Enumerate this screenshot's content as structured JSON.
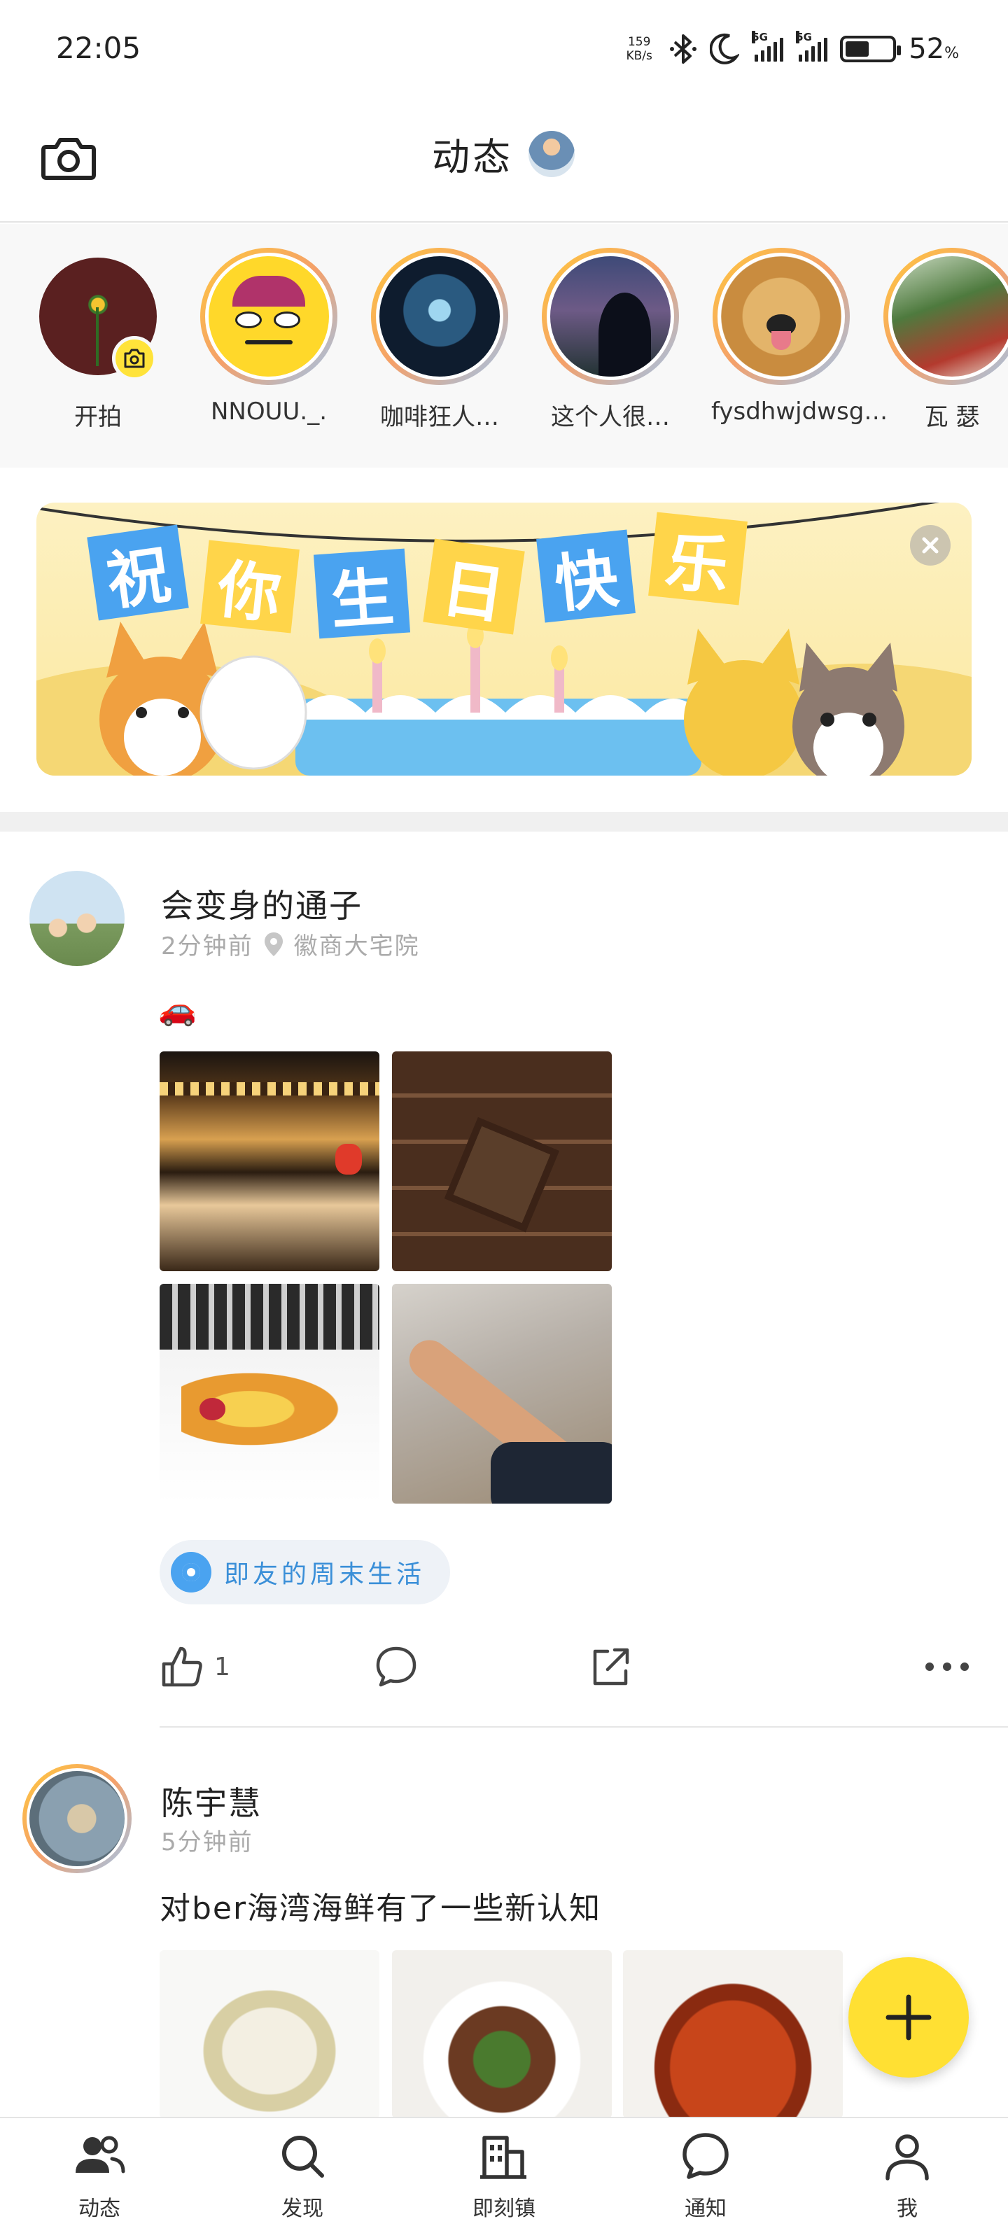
{
  "status_bar": {
    "time": "22:05",
    "net_speed_value": "159",
    "net_speed_unit": "KB/s",
    "signal_label_1": "5G",
    "signal_label_2": "5G",
    "battery_percent": "52",
    "battery_unit": "%",
    "battery_level": 0.52
  },
  "header": {
    "title": "动态"
  },
  "stories": [
    {
      "name": "开拍"
    },
    {
      "name": "NNOUU._."
    },
    {
      "name": "咖啡狂人…"
    },
    {
      "name": "这个人很…"
    },
    {
      "name": "fysdhwjdwsg…"
    },
    {
      "name": "瓦 瑟"
    }
  ],
  "banner": {
    "characters": [
      "祝",
      "你",
      "生",
      "日",
      "快",
      "乐"
    ],
    "flag_colors": [
      "#4aa3f0",
      "#ffd54a",
      "#4aa3f0",
      "#ffd54a",
      "#4aa3f0",
      "#ffd54a"
    ]
  },
  "posts": [
    {
      "author": "会变身的通子",
      "time": "2分钟前",
      "location": "徽商大宅院",
      "text": "🚗",
      "topic": "即友的周末生活",
      "like_count": "1"
    },
    {
      "author": "陈宇慧",
      "time": "5分钟前",
      "text": "对ber海湾海鲜有了一些新认知"
    }
  ],
  "nav": [
    {
      "label": "动态"
    },
    {
      "label": "发现"
    },
    {
      "label": "即刻镇"
    },
    {
      "label": "通知"
    },
    {
      "label": "我"
    }
  ],
  "colors": {
    "accent_yellow": "#ffe033",
    "topic_blue": "#3a8fd8"
  }
}
